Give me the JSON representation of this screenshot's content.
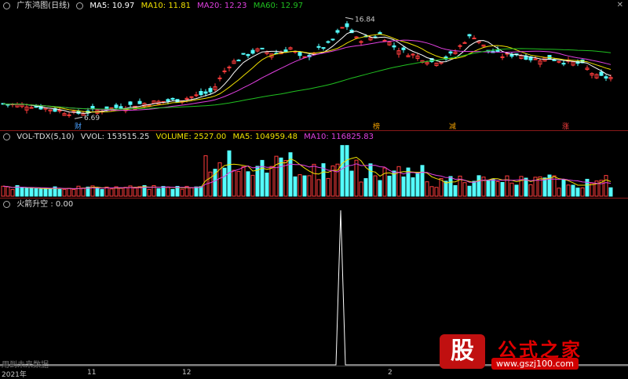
{
  "main_panel": {
    "title": "广东鸿图(日线)",
    "ma": [
      {
        "label": "MA5: 10.97",
        "color": "#ffffff"
      },
      {
        "label": "MA10: 11.81",
        "color": "#f0e000"
      },
      {
        "label": "MA20: 12.23",
        "color": "#e040e0"
      },
      {
        "label": "MA60: 12.97",
        "color": "#20c020"
      }
    ],
    "high_label": "16.84",
    "low_label": "6.69",
    "markers": [
      {
        "text": "财",
        "color": "#4aa0ff"
      },
      {
        "text": "榜",
        "color": "#f0a000"
      },
      {
        "text": "减",
        "color": "#f0a000"
      },
      {
        "text": "涨",
        "color": "#ff4040"
      }
    ]
  },
  "vol_panel": {
    "title": "VOL-TDX(5,10)",
    "vol": "VVOL: 153515.25",
    "volume": "VOLUME: 2527.00",
    "ma5": "MA5: 104959.48",
    "ma10": "MA10: 116825.83"
  },
  "ind_panel": {
    "title": "火箭升空 : 0.00",
    "note": "用到未来数据"
  },
  "x_axis": {
    "labels": [
      "2021年",
      "11",
      "12",
      "2"
    ]
  },
  "watermark": {
    "logo": "股",
    "text": "公式之家",
    "url": "www.gszj100.com"
  },
  "chart_data": {
    "type": "candlestick",
    "title": "广东鸿图(日线)",
    "high_price": 16.84,
    "low_price": 6.69,
    "ma": {
      "MA5": 10.97,
      "MA10": 11.81,
      "MA20": 12.23,
      "MA60": 12.97
    },
    "volume": {
      "VVOL": 153515.25,
      "VOLUME": 2527.0,
      "MA5": 104959.48,
      "MA10": 116825.83
    },
    "indicator": {
      "name": "火箭升空",
      "value": 0.0,
      "spike_value": 1
    },
    "x_tick_labels": [
      "2021年",
      "11",
      "12",
      "2"
    ]
  }
}
